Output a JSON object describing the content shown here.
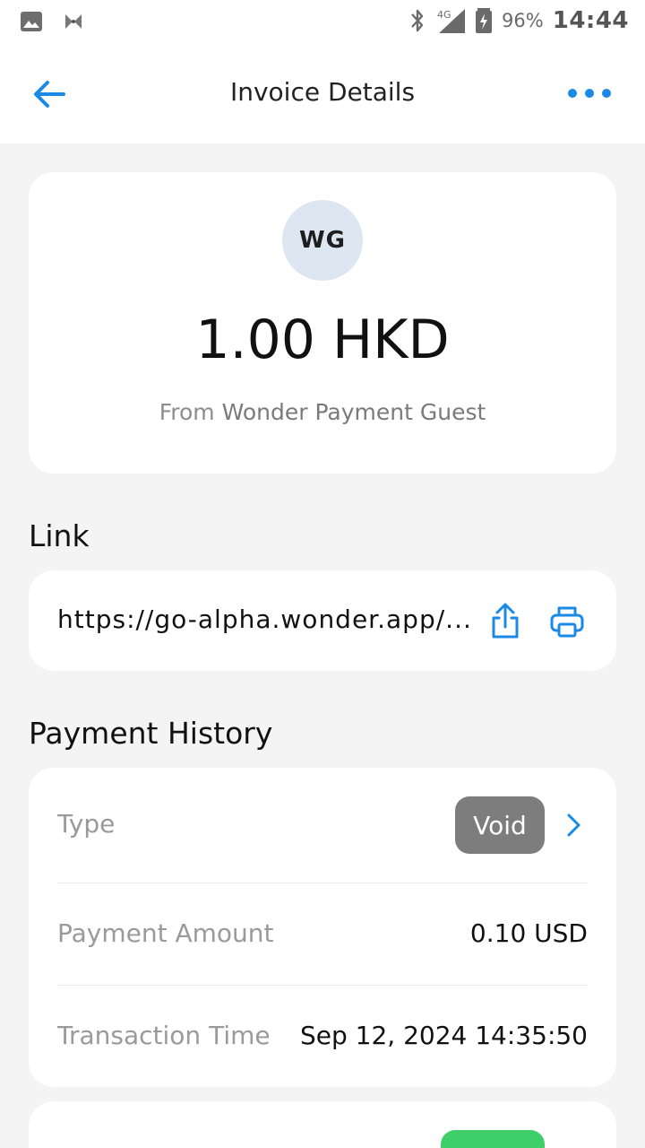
{
  "status_bar": {
    "battery": "96%",
    "time": "14:44",
    "network": "4G",
    "icons": [
      "image-icon",
      "app-notification-icon",
      "bluetooth-icon",
      "signal-icon",
      "battery-charging-icon"
    ]
  },
  "header": {
    "title": "Invoice Details",
    "back_icon": "arrow-left-icon",
    "more_icon": "more-horizontal-icon"
  },
  "summary": {
    "initials": "WG",
    "amount": "1.00 HKD",
    "from_prefix": "From",
    "from_name": "Wonder Payment Guest"
  },
  "link_section": {
    "title": "Link",
    "url": "https://go-alpha.wonder.app/...",
    "share_icon": "share-icon",
    "print_icon": "print-icon"
  },
  "payment_history": {
    "title": "Payment History",
    "type_label": "Type",
    "type_value": "Void",
    "amount_label": "Payment Amount",
    "amount_value": "0.10 USD",
    "time_label": "Transaction Time",
    "time_value": "Sep 12, 2024 14:35:50"
  },
  "colors": {
    "accent": "#1a8ae6",
    "background": "#f4f4f4",
    "card": "#ffffff",
    "void_badge": "#7d7d7d",
    "success_badge": "#3fcf6a",
    "avatar_bg": "#dde7f1"
  }
}
